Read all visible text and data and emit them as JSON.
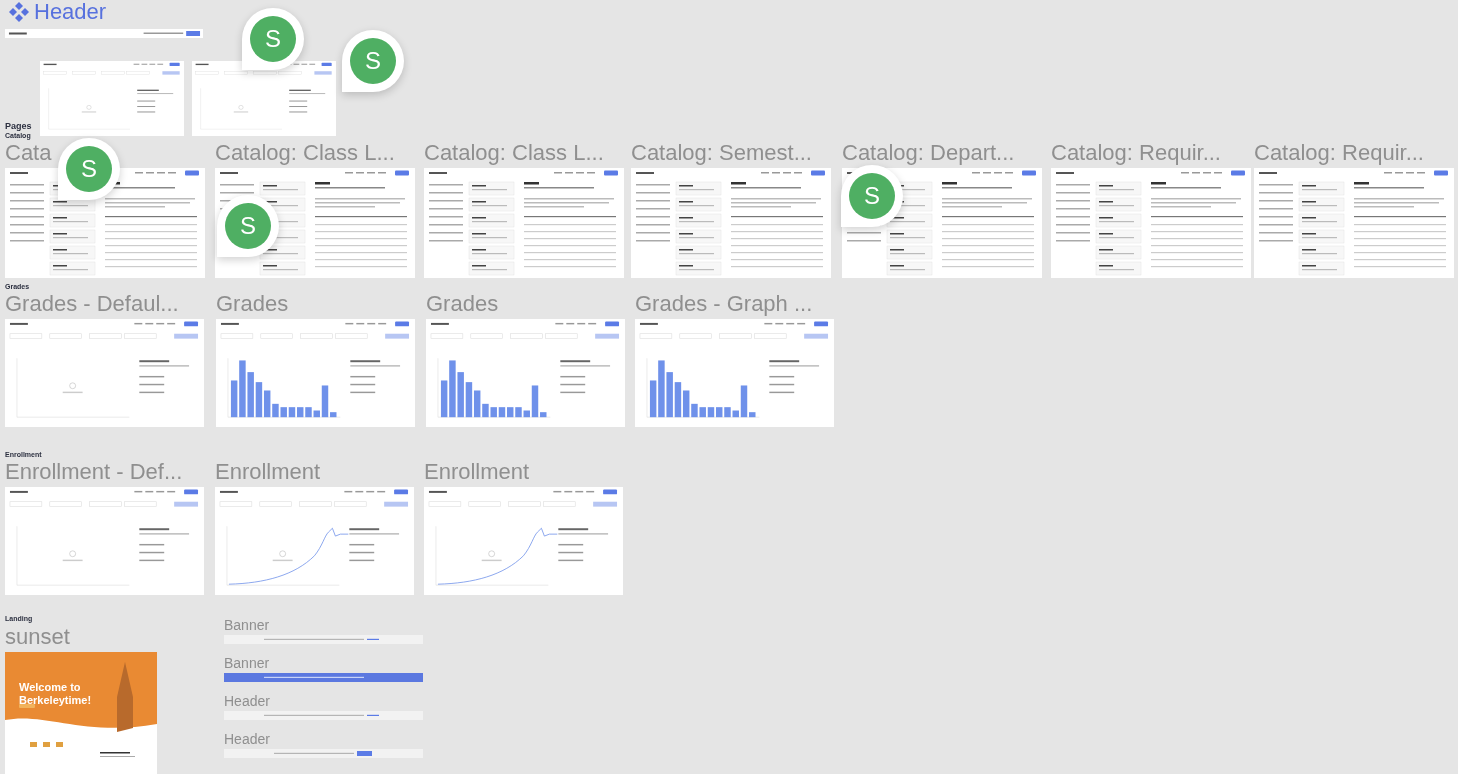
{
  "header_component": {
    "label": "Header",
    "previews": [
      {
        "kind": "header-bar"
      },
      {
        "kind": "empty-chart"
      },
      {
        "kind": "empty-chart"
      }
    ]
  },
  "pages_label": "Pages",
  "sections": [
    {
      "label": "Catalog",
      "frames": [
        {
          "title": "Cata",
          "kind": "catalog"
        },
        {
          "title": "Catalog: Class L...",
          "kind": "catalog"
        },
        {
          "title": "Catalog: Class L...",
          "kind": "catalog"
        },
        {
          "title": "Catalog: Semest...",
          "kind": "catalog"
        },
        {
          "title": "Catalog: Depart...",
          "kind": "catalog"
        },
        {
          "title": "Catalog: Requir...",
          "kind": "catalog"
        },
        {
          "title": "Catalog: Requir...",
          "kind": "catalog"
        }
      ]
    },
    {
      "label": "Grades",
      "frames": [
        {
          "title": "Grades - Defaul...",
          "kind": "empty-chart"
        },
        {
          "title": "Grades",
          "kind": "grades"
        },
        {
          "title": "Grades",
          "kind": "grades"
        },
        {
          "title": "Grades - Graph ...",
          "kind": "grades"
        }
      ]
    },
    {
      "label": "Enrollment",
      "frames": [
        {
          "title": "Enrollment - Def...",
          "kind": "empty-chart"
        },
        {
          "title": "Enrollment",
          "kind": "enrollment"
        },
        {
          "title": "Enrollment",
          "kind": "enrollment"
        }
      ]
    },
    {
      "label": "Landing",
      "frames": [
        {
          "title": "sunset",
          "kind": "landing",
          "heading": "Welcome to Berkeleytime!"
        }
      ]
    }
  ],
  "banner_titles": [
    "Banner",
    "Banner",
    "Header",
    "Header"
  ],
  "banners": [
    {
      "kind": "light"
    },
    {
      "kind": "blue"
    },
    {
      "kind": "light"
    },
    {
      "kind": "light"
    }
  ],
  "cursors": [
    {
      "initial": "S"
    },
    {
      "initial": "S"
    },
    {
      "initial": "S"
    },
    {
      "initial": "S"
    },
    {
      "initial": "S"
    }
  ]
}
